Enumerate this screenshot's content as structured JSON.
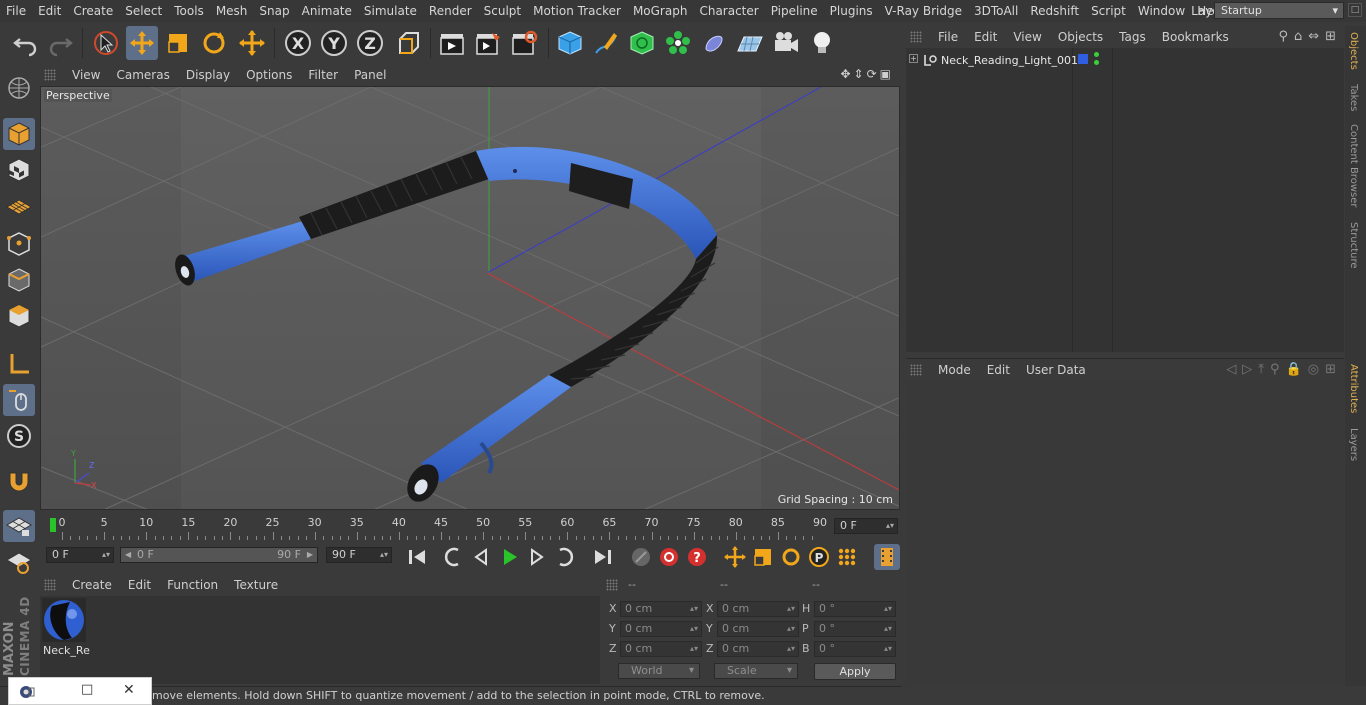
{
  "menubar": {
    "items": [
      "File",
      "Edit",
      "Create",
      "Select",
      "Tools",
      "Mesh",
      "Snap",
      "Animate",
      "Simulate",
      "Render",
      "Sculpt",
      "Motion Tracker",
      "MoGraph",
      "Character",
      "Pipeline",
      "Plugins",
      "V-Ray Bridge",
      "3DToAll",
      "Redshift",
      "Script",
      "Window",
      "Help"
    ],
    "layout_label": "Layout:",
    "layout_value": "Startup"
  },
  "viewport": {
    "menu": [
      "View",
      "Cameras",
      "Display",
      "Options",
      "Filter",
      "Panel"
    ],
    "camera_label": "Perspective",
    "grid_spacing": "Grid Spacing : 10 cm",
    "axis_labels": {
      "y": "Y",
      "z": "Z",
      "x": "X"
    }
  },
  "timeline": {
    "ticks": [
      "0",
      "5",
      "10",
      "15",
      "20",
      "25",
      "30",
      "35",
      "40",
      "45",
      "50",
      "55",
      "60",
      "65",
      "70",
      "75",
      "80",
      "85",
      "90"
    ],
    "current_frame": "0 F",
    "start_field": "0 F",
    "range_start": "0 F",
    "range_end": "90 F",
    "end_field": "90 F"
  },
  "material_manager": {
    "menu": [
      "Create",
      "Edit",
      "Function",
      "Texture"
    ],
    "material_name": "Neck_Re"
  },
  "coordinates": {
    "headers": [
      "--",
      "--",
      "--"
    ],
    "rows": [
      {
        "a1": "X",
        "v1": "0 cm",
        "a2": "X",
        "v2": "0 cm",
        "a3": "H",
        "v3": "0 °"
      },
      {
        "a1": "Y",
        "v1": "0 cm",
        "a2": "Y",
        "v2": "0 cm",
        "a3": "P",
        "v3": "0 °"
      },
      {
        "a1": "Z",
        "v1": "0 cm",
        "a2": "Z",
        "v2": "0 cm",
        "a3": "B",
        "v3": "0 °"
      }
    ],
    "mode_dropdown": "World",
    "scale_dropdown": "Scale",
    "apply_label": "Apply"
  },
  "status_bar": {
    "text": "move elements. Hold down SHIFT to quantize movement / add to the selection in point mode, CTRL to remove."
  },
  "object_manager": {
    "menu": [
      "File",
      "Edit",
      "View",
      "Objects",
      "Tags",
      "Bookmarks"
    ],
    "object_name": "Neck_Reading_Light_001",
    "object_color": "#2f5fe0"
  },
  "attribute_manager": {
    "menu": [
      "Mode",
      "Edit",
      "User Data"
    ]
  },
  "right_tabs": [
    "Objects",
    "Takes",
    "Content Browser",
    "Structure",
    "Attributes",
    "Layers"
  ],
  "brand": {
    "line1": "MAXON",
    "line2": "CINEMA 4D"
  },
  "colors": {
    "accent": "#5e6f8a",
    "model_blue": "#3a6fd8",
    "play_green": "#29c429",
    "record_red": "#d43030"
  }
}
